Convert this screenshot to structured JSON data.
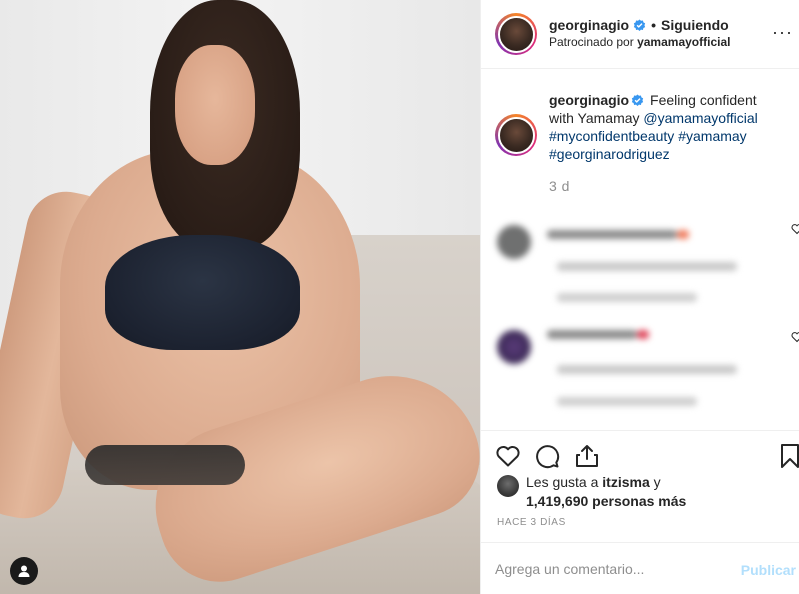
{
  "header": {
    "username": "georginagio",
    "separator": "•",
    "following": "Siguiendo",
    "sponsored_prefix": "Patrocinado por",
    "sponsor": "yamamayofficial",
    "more_icon": "more-options-icon",
    "more_glyph": "···"
  },
  "caption": {
    "username": "georginagio",
    "text": " Feeling confident with Yamamay ",
    "mention": "@yamamayofficial",
    "tags": [
      "#myconfidentbeauty",
      "#yamamay",
      "#georginarodriguez"
    ],
    "age": "3 d"
  },
  "likes": {
    "prefix": "Les gusta a ",
    "liker": "itzisma",
    "middle": " y",
    "count": "1,419,690 personas más"
  },
  "timestamp": "HACE 3 DÍAS",
  "comment_box": {
    "placeholder": "Agrega un comentario...",
    "publish": "Publicar"
  },
  "colors": {
    "verified": "#3897f0",
    "link": "#00376b",
    "muted": "#8e8e8e",
    "publish_disabled": "#b2dffc"
  }
}
